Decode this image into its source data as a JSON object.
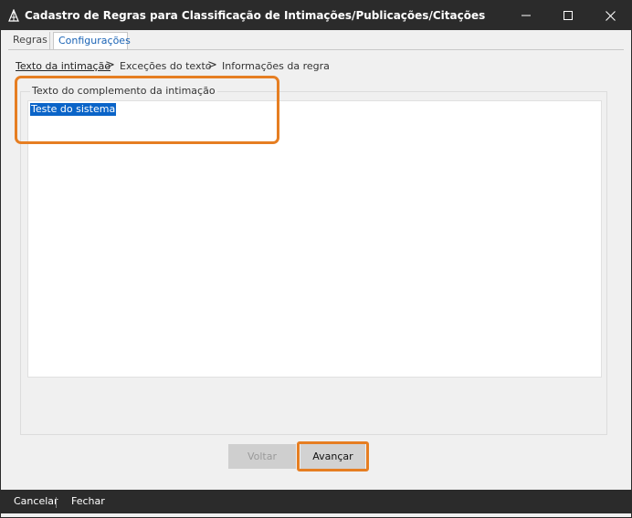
{
  "window": {
    "title": "Cadastro de Regras para Classificação de Intimações/Publicações/Citações",
    "app_icon": "triangle-logo-icon",
    "controls": {
      "minimize": "minimize-icon",
      "maximize": "maximize-icon",
      "close": "close-icon"
    }
  },
  "tabs": [
    {
      "label": "Regras",
      "active": false
    },
    {
      "label": "Configurações",
      "active": true
    }
  ],
  "breadcrumb": {
    "steps": [
      "Texto da intimação",
      "Exceções do texto",
      "Informações da regra"
    ],
    "separator": ">"
  },
  "group": {
    "legend": "Texto do complemento da intimação",
    "text_value": "Teste do sistema"
  },
  "buttons": {
    "back": "Voltar",
    "next": "Avançar"
  },
  "footer": {
    "cancel": "Cancelar",
    "close": "Fechar"
  },
  "colors": {
    "titlebar": "#2b2b2b",
    "highlight": "#e67e22",
    "selection": "#0a64c8",
    "active_tab_text": "#1a63b5"
  }
}
